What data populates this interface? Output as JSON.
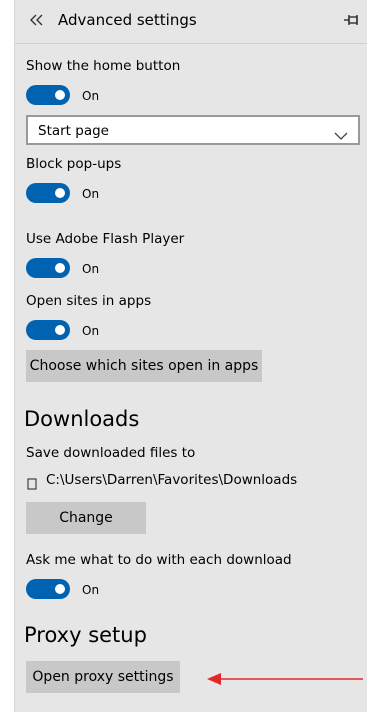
{
  "header": {
    "title": "Advanced settings",
    "back_icon": "double-chevron-left-icon",
    "pin_icon": "pin-icon"
  },
  "home_button": {
    "label": "Show the home button",
    "toggle_state": "On",
    "toggle_on": true,
    "select_value": "Start page"
  },
  "popups": {
    "label": "Block pop-ups",
    "toggle_state": "On",
    "toggle_on": true
  },
  "flash": {
    "label": "Use Adobe Flash Player",
    "toggle_state": "On",
    "toggle_on": true
  },
  "apps": {
    "label": "Open sites in apps",
    "toggle_state": "On",
    "toggle_on": true,
    "button_label": "Choose which sites open in apps"
  },
  "downloads": {
    "heading": "Downloads",
    "save_label": "Save downloaded files to",
    "path": "C:\\Users\\Darren\\Favorites\\Downloads",
    "change_label": "Change",
    "ask_label": "Ask me what to do with each download",
    "toggle_state": "On",
    "toggle_on": true
  },
  "proxy": {
    "heading": "Proxy setup",
    "button_label": "Open proxy settings"
  },
  "colors": {
    "panel_bg": "#e6e6e6",
    "toggle_on": "#0063b1",
    "button_bg": "#c8c8c8",
    "annotation_arrow": "#e2272b"
  }
}
